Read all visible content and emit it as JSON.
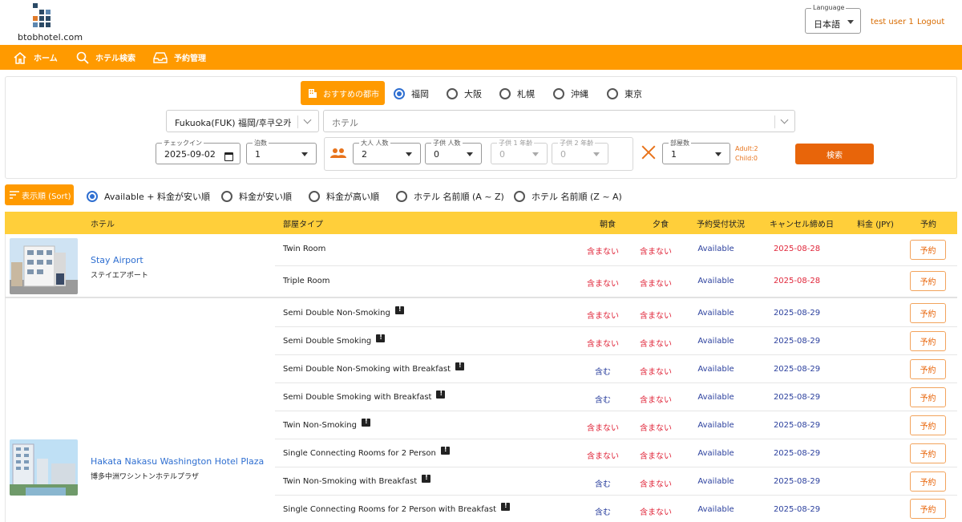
{
  "header": {
    "logo_text": "btobhotel.com",
    "language_label": "Language",
    "language_value": "日本語",
    "user_name": "test user 1",
    "logout_label": "Logout"
  },
  "nav": {
    "items": [
      {
        "label": "ホーム",
        "icon": "home-icon"
      },
      {
        "label": "ホテル検索",
        "icon": "search-icon"
      },
      {
        "label": "予約管理",
        "icon": "inbox-icon"
      }
    ]
  },
  "search": {
    "recommended_button": "おすすめの都市",
    "cities": [
      "福岡",
      "大阪",
      "札幌",
      "沖縄",
      "東京"
    ],
    "selected_city": "福岡",
    "area_value": "Fukuoka(FUK) 福岡/후쿠오카",
    "hotel_placeholder": "ホテル",
    "checkin_label": "チェックイン",
    "checkin_value": "2025-09-02",
    "nights_label": "泊数",
    "nights_value": "1",
    "adults_label": "大人 人数",
    "adults_value": "2",
    "children_label": "子供 人数",
    "children_value": "0",
    "child1_label": "子供 1 年齢",
    "child1_value": "0",
    "child2_label": "子供 2 年齢",
    "child2_value": "0",
    "rooms_label": "部屋数",
    "rooms_value": "1",
    "adult_note": "Adult:2",
    "child_note": "Child:0",
    "search_button": "検索"
  },
  "sort": {
    "button_label": "表示順 (Sort)",
    "options": [
      "Available + 料金が安い順",
      "料金が安い順",
      "料金が高い順",
      "ホテル 名前順 (A ~ Z)",
      "ホテル 名前順 (Z ~ A)"
    ],
    "selected": "Available + 料金が安い順"
  },
  "table": {
    "headers": {
      "hotel": "ホテル",
      "room_type": "部屋タイプ",
      "breakfast": "朝食",
      "dinner": "夕食",
      "status": "予約受付状況",
      "cancel_deadline": "キャンセル締め日",
      "price": "料金 (JPY)",
      "book": "予約"
    },
    "hotels": [
      {
        "name": "Stay Airport",
        "name_jp": "ステイエアポート",
        "rooms": [
          {
            "type": "Twin Room",
            "breakfast": "含まない",
            "dinner": "含まない",
            "status": "Available",
            "cancel": "2025-08-28",
            "book": "予約"
          },
          {
            "type": "Triple Room",
            "breakfast": "含まない",
            "dinner": "含まない",
            "status": "Available",
            "cancel": "2025-08-28",
            "book": "予約"
          }
        ]
      },
      {
        "name": "Hakata Nakasu Washington Hotel Plaza",
        "name_jp": "博多中洲ワシントンホテルプラザ",
        "rooms": [
          {
            "type": "Semi Double Non-Smoking",
            "breakfast": "含まない",
            "dinner": "含まない",
            "status": "Available",
            "cancel": "2025-08-29",
            "book": "予約"
          },
          {
            "type": "Semi Double Smoking",
            "breakfast": "含まない",
            "dinner": "含まない",
            "status": "Available",
            "cancel": "2025-08-29",
            "book": "予約"
          },
          {
            "type": "Semi Double Non-Smoking with Breakfast",
            "breakfast": "含む",
            "dinner": "含まない",
            "status": "Available",
            "cancel": "2025-08-29",
            "book": "予約"
          },
          {
            "type": "Semi Double Smoking with Breakfast",
            "breakfast": "含む",
            "dinner": "含まない",
            "status": "Available",
            "cancel": "2025-08-29",
            "book": "予約"
          },
          {
            "type": "Twin Non-Smoking",
            "breakfast": "含まない",
            "dinner": "含まない",
            "status": "Available",
            "cancel": "2025-08-29",
            "book": "予約"
          },
          {
            "type": "Single Connecting Rooms for 2 Person",
            "breakfast": "含まない",
            "dinner": "含まない",
            "status": "Available",
            "cancel": "2025-08-29",
            "book": "予約"
          },
          {
            "type": "Twin Non-Smoking with Breakfast",
            "breakfast": "含む",
            "dinner": "含まない",
            "status": "Available",
            "cancel": "2025-08-29",
            "book": "予約"
          },
          {
            "type": "Single Connecting Rooms for 2 Person with Breakfast",
            "breakfast": "含む",
            "dinner": "含まない",
            "status": "Available",
            "cancel": "2025-08-29",
            "book": "予約"
          }
        ]
      }
    ]
  },
  "colors": {
    "accent": "#ff9a00",
    "header_row": "#ffcf3a",
    "search_button": "#e8650a",
    "link_blue": "#2f6fd1",
    "status_blue": "#2a3f9d",
    "red": "#e0263a"
  }
}
